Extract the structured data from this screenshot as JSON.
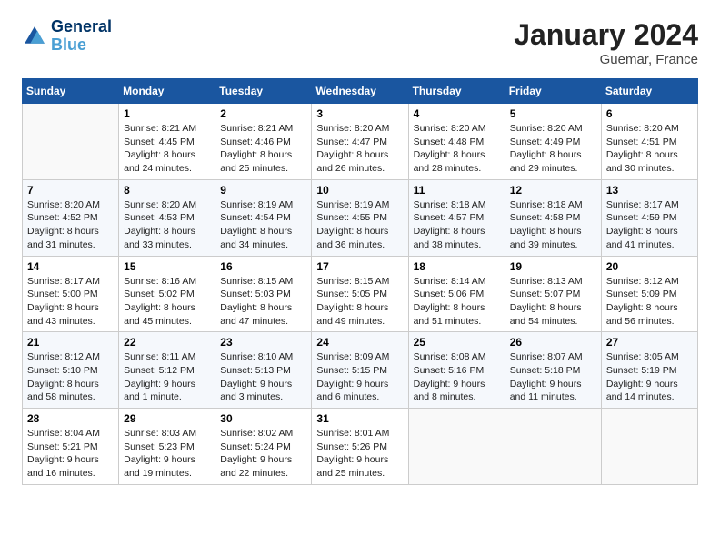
{
  "header": {
    "logo_line1": "General",
    "logo_line2": "Blue",
    "title": "January 2024",
    "subtitle": "Guemar, France"
  },
  "days_of_week": [
    "Sunday",
    "Monday",
    "Tuesday",
    "Wednesday",
    "Thursday",
    "Friday",
    "Saturday"
  ],
  "weeks": [
    [
      {
        "num": "",
        "sunrise": "",
        "sunset": "",
        "daylight": ""
      },
      {
        "num": "1",
        "sunrise": "Sunrise: 8:21 AM",
        "sunset": "Sunset: 4:45 PM",
        "daylight": "Daylight: 8 hours and 24 minutes."
      },
      {
        "num": "2",
        "sunrise": "Sunrise: 8:21 AM",
        "sunset": "Sunset: 4:46 PM",
        "daylight": "Daylight: 8 hours and 25 minutes."
      },
      {
        "num": "3",
        "sunrise": "Sunrise: 8:20 AM",
        "sunset": "Sunset: 4:47 PM",
        "daylight": "Daylight: 8 hours and 26 minutes."
      },
      {
        "num": "4",
        "sunrise": "Sunrise: 8:20 AM",
        "sunset": "Sunset: 4:48 PM",
        "daylight": "Daylight: 8 hours and 28 minutes."
      },
      {
        "num": "5",
        "sunrise": "Sunrise: 8:20 AM",
        "sunset": "Sunset: 4:49 PM",
        "daylight": "Daylight: 8 hours and 29 minutes."
      },
      {
        "num": "6",
        "sunrise": "Sunrise: 8:20 AM",
        "sunset": "Sunset: 4:51 PM",
        "daylight": "Daylight: 8 hours and 30 minutes."
      }
    ],
    [
      {
        "num": "7",
        "sunrise": "Sunrise: 8:20 AM",
        "sunset": "Sunset: 4:52 PM",
        "daylight": "Daylight: 8 hours and 31 minutes."
      },
      {
        "num": "8",
        "sunrise": "Sunrise: 8:20 AM",
        "sunset": "Sunset: 4:53 PM",
        "daylight": "Daylight: 8 hours and 33 minutes."
      },
      {
        "num": "9",
        "sunrise": "Sunrise: 8:19 AM",
        "sunset": "Sunset: 4:54 PM",
        "daylight": "Daylight: 8 hours and 34 minutes."
      },
      {
        "num": "10",
        "sunrise": "Sunrise: 8:19 AM",
        "sunset": "Sunset: 4:55 PM",
        "daylight": "Daylight: 8 hours and 36 minutes."
      },
      {
        "num": "11",
        "sunrise": "Sunrise: 8:18 AM",
        "sunset": "Sunset: 4:57 PM",
        "daylight": "Daylight: 8 hours and 38 minutes."
      },
      {
        "num": "12",
        "sunrise": "Sunrise: 8:18 AM",
        "sunset": "Sunset: 4:58 PM",
        "daylight": "Daylight: 8 hours and 39 minutes."
      },
      {
        "num": "13",
        "sunrise": "Sunrise: 8:17 AM",
        "sunset": "Sunset: 4:59 PM",
        "daylight": "Daylight: 8 hours and 41 minutes."
      }
    ],
    [
      {
        "num": "14",
        "sunrise": "Sunrise: 8:17 AM",
        "sunset": "Sunset: 5:00 PM",
        "daylight": "Daylight: 8 hours and 43 minutes."
      },
      {
        "num": "15",
        "sunrise": "Sunrise: 8:16 AM",
        "sunset": "Sunset: 5:02 PM",
        "daylight": "Daylight: 8 hours and 45 minutes."
      },
      {
        "num": "16",
        "sunrise": "Sunrise: 8:15 AM",
        "sunset": "Sunset: 5:03 PM",
        "daylight": "Daylight: 8 hours and 47 minutes."
      },
      {
        "num": "17",
        "sunrise": "Sunrise: 8:15 AM",
        "sunset": "Sunset: 5:05 PM",
        "daylight": "Daylight: 8 hours and 49 minutes."
      },
      {
        "num": "18",
        "sunrise": "Sunrise: 8:14 AM",
        "sunset": "Sunset: 5:06 PM",
        "daylight": "Daylight: 8 hours and 51 minutes."
      },
      {
        "num": "19",
        "sunrise": "Sunrise: 8:13 AM",
        "sunset": "Sunset: 5:07 PM",
        "daylight": "Daylight: 8 hours and 54 minutes."
      },
      {
        "num": "20",
        "sunrise": "Sunrise: 8:12 AM",
        "sunset": "Sunset: 5:09 PM",
        "daylight": "Daylight: 8 hours and 56 minutes."
      }
    ],
    [
      {
        "num": "21",
        "sunrise": "Sunrise: 8:12 AM",
        "sunset": "Sunset: 5:10 PM",
        "daylight": "Daylight: 8 hours and 58 minutes."
      },
      {
        "num": "22",
        "sunrise": "Sunrise: 8:11 AM",
        "sunset": "Sunset: 5:12 PM",
        "daylight": "Daylight: 9 hours and 1 minute."
      },
      {
        "num": "23",
        "sunrise": "Sunrise: 8:10 AM",
        "sunset": "Sunset: 5:13 PM",
        "daylight": "Daylight: 9 hours and 3 minutes."
      },
      {
        "num": "24",
        "sunrise": "Sunrise: 8:09 AM",
        "sunset": "Sunset: 5:15 PM",
        "daylight": "Daylight: 9 hours and 6 minutes."
      },
      {
        "num": "25",
        "sunrise": "Sunrise: 8:08 AM",
        "sunset": "Sunset: 5:16 PM",
        "daylight": "Daylight: 9 hours and 8 minutes."
      },
      {
        "num": "26",
        "sunrise": "Sunrise: 8:07 AM",
        "sunset": "Sunset: 5:18 PM",
        "daylight": "Daylight: 9 hours and 11 minutes."
      },
      {
        "num": "27",
        "sunrise": "Sunrise: 8:05 AM",
        "sunset": "Sunset: 5:19 PM",
        "daylight": "Daylight: 9 hours and 14 minutes."
      }
    ],
    [
      {
        "num": "28",
        "sunrise": "Sunrise: 8:04 AM",
        "sunset": "Sunset: 5:21 PM",
        "daylight": "Daylight: 9 hours and 16 minutes."
      },
      {
        "num": "29",
        "sunrise": "Sunrise: 8:03 AM",
        "sunset": "Sunset: 5:23 PM",
        "daylight": "Daylight: 9 hours and 19 minutes."
      },
      {
        "num": "30",
        "sunrise": "Sunrise: 8:02 AM",
        "sunset": "Sunset: 5:24 PM",
        "daylight": "Daylight: 9 hours and 22 minutes."
      },
      {
        "num": "31",
        "sunrise": "Sunrise: 8:01 AM",
        "sunset": "Sunset: 5:26 PM",
        "daylight": "Daylight: 9 hours and 25 minutes."
      },
      {
        "num": "",
        "sunrise": "",
        "sunset": "",
        "daylight": ""
      },
      {
        "num": "",
        "sunrise": "",
        "sunset": "",
        "daylight": ""
      },
      {
        "num": "",
        "sunrise": "",
        "sunset": "",
        "daylight": ""
      }
    ]
  ]
}
